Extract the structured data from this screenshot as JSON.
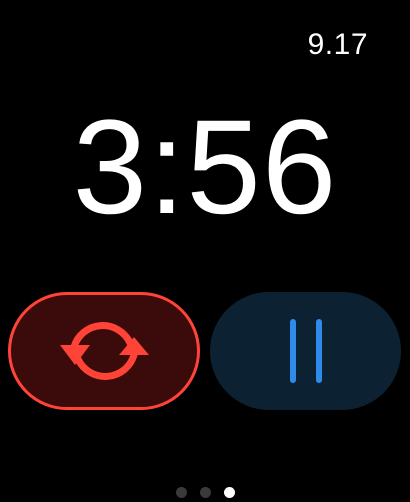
{
  "status_bar": {
    "time": "9.17"
  },
  "timer": {
    "display": "3:56"
  },
  "controls": {
    "reset": {
      "icon": "reset-arrows-icon",
      "color": "#ff4437",
      "background": "#3a0b0a"
    },
    "pause": {
      "icon": "pause-icon",
      "color": "#2f8bea",
      "background": "#0c2233"
    }
  },
  "pagination": {
    "page_count": 3,
    "current_page": 3
  }
}
